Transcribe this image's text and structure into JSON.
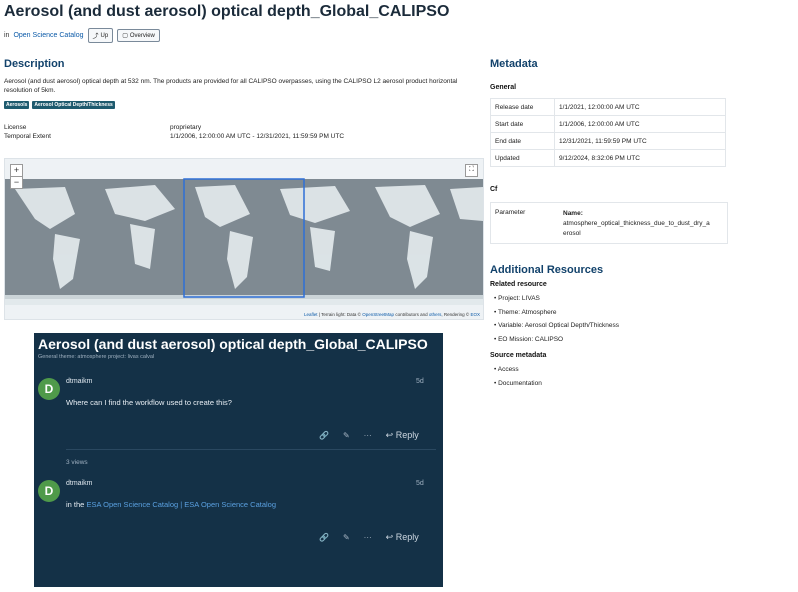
{
  "header": {
    "title": "Aerosol (and dust aerosol) optical depth_Global_CALIPSO",
    "catalog_prefix": "in",
    "catalog_link": "Open Science Catalog",
    "up_label": "Up",
    "overview_label": "Overview"
  },
  "description": {
    "heading": "Description",
    "text": "Aerosol (and dust aerosol) optical depth at 532 nm. The products are provided for all CALIPSO overpasses, using the CALIPSO L2 aerosol product horizontal resolution of 5km.",
    "tags": [
      "Aerosols",
      "Aerosol Optical Depth/Thickness"
    ],
    "properties": [
      {
        "key": "License",
        "value": "proprietary"
      },
      {
        "key": "Temporal Extent",
        "value": "1/1/2006, 12:00:00 AM UTC - 12/31/2021, 11:59:59 PM UTC"
      }
    ]
  },
  "map": {
    "zoom_in": "+",
    "zoom_out": "−",
    "fullscreen": "⛶",
    "attribution_leaflet": "Leaflet",
    "attribution_mid": "| Terrain light: Data ©",
    "attribution_osm": "OpenStreetMap",
    "attribution_mid2": "contributors and",
    "attribution_others": "others",
    "attribution_end": ", Rendering ©",
    "attribution_eox": "EOX"
  },
  "metadata": {
    "heading": "Metadata",
    "general_heading": "General",
    "general": [
      {
        "key": "Release date",
        "value": "1/1/2021, 12:00:00 AM UTC"
      },
      {
        "key": "Start date",
        "value": "1/1/2006, 12:00:00 AM UTC"
      },
      {
        "key": "End date",
        "value": "12/31/2021, 11:59:59 PM UTC"
      },
      {
        "key": "Updated",
        "value": "9/12/2024, 8:32:06 PM UTC"
      }
    ],
    "cf_heading": "Cf",
    "cf_key": "Parameter",
    "cf_name_label": "Name:",
    "cf_name_line1": "atmosphere_optical_thickness_due_to_dust_dry_a",
    "cf_name_line2": "erosol"
  },
  "resources": {
    "heading": "Additional Resources",
    "related_heading": "Related resource",
    "related": [
      "Project: LIVAS",
      "Theme: Atmosphere",
      "Variable: Aerosol Optical Depth/Thickness",
      "EO Mission: CALIPSO"
    ],
    "source_heading": "Source metadata",
    "source": [
      "Access",
      "Documentation"
    ]
  },
  "forum": {
    "title": "Aerosol (and dust aerosol) optical depth_Global_CALIPSO",
    "crumb": "General  theme: atmosphere  project: livas  calval",
    "post1": {
      "avatar": "D",
      "user": "dtmaikm",
      "age": "5d",
      "text": "Where can I find the workflow used to create this?"
    },
    "views": "3 views",
    "post2": {
      "avatar": "D",
      "user": "dtmaikm",
      "age": "5d",
      "text_prefix": "in the",
      "link": "ESA Open Science Catalog | ESA Open Science Catalog"
    },
    "reply_label": "Reply",
    "more_label": "···"
  },
  "colors": {
    "accent": "#12426b",
    "forum_bg": "#143147",
    "avatar": "#4f9a4a",
    "tag": "#1e5a6e"
  }
}
